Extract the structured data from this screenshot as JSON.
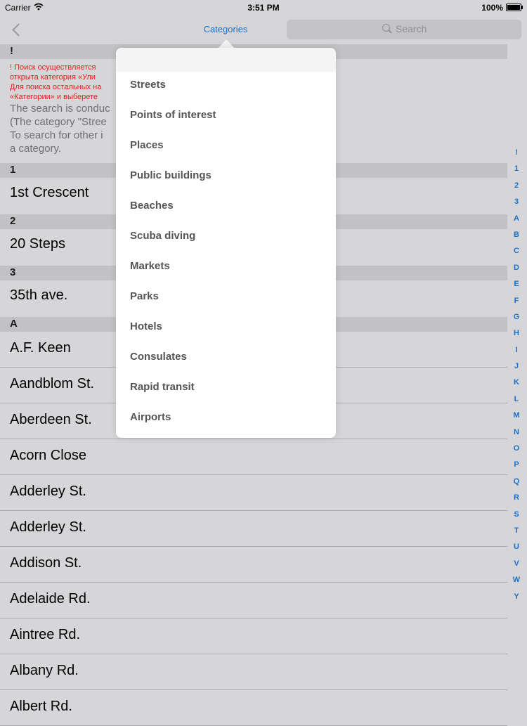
{
  "status_bar": {
    "carrier": "Carrier",
    "wifi_icon": "wifi-icon",
    "time": "3:51 PM",
    "battery": "100%"
  },
  "nav": {
    "back_icon": "chevron-left-icon",
    "title": "Categories",
    "search_placeholder": "Search"
  },
  "notice": {
    "header": "!",
    "ru_lines": [
      "! Поиск осуществляется",
      "открыта категория «Ули",
      "Для поиска остальных на",
      "«Категории» и выберете"
    ],
    "en_lines": [
      "The search is conduc",
      "(The category \"Stree",
      "To search for other i",
      "a category."
    ]
  },
  "sections": [
    {
      "header": "1",
      "rows": [
        "1st Crescent"
      ]
    },
    {
      "header": "2",
      "rows": [
        "20 Steps"
      ]
    },
    {
      "header": "3",
      "rows": [
        "35th ave."
      ]
    },
    {
      "header": "A",
      "rows": [
        "A.F. Keen",
        "Aandblom St.",
        "Aberdeen St.",
        "Acorn Close",
        "Adderley St.",
        "Adderley St.",
        "Addison St.",
        "Adelaide Rd.",
        "Aintree Rd.",
        "Albany Rd.",
        "Albert Rd."
      ]
    }
  ],
  "index_letters": [
    "!",
    "1",
    "2",
    "3",
    "A",
    "B",
    "C",
    "D",
    "E",
    "F",
    "G",
    "H",
    "I",
    "J",
    "K",
    "L",
    "M",
    "N",
    "O",
    "P",
    "Q",
    "R",
    "S",
    "T",
    "U",
    "V",
    "W",
    "Y"
  ],
  "categories": [
    "Streets",
    "Points of interest",
    "Places",
    "Public buildings",
    "Beaches",
    "Scuba diving",
    "Markets",
    "Parks",
    "Hotels",
    "Consulates",
    "Rapid transit",
    "Airports"
  ],
  "colors": {
    "accent": "#1e6fc6",
    "warning": "#e0201c",
    "background": "#d6d6d8",
    "section_header": "#c2c2c4"
  }
}
